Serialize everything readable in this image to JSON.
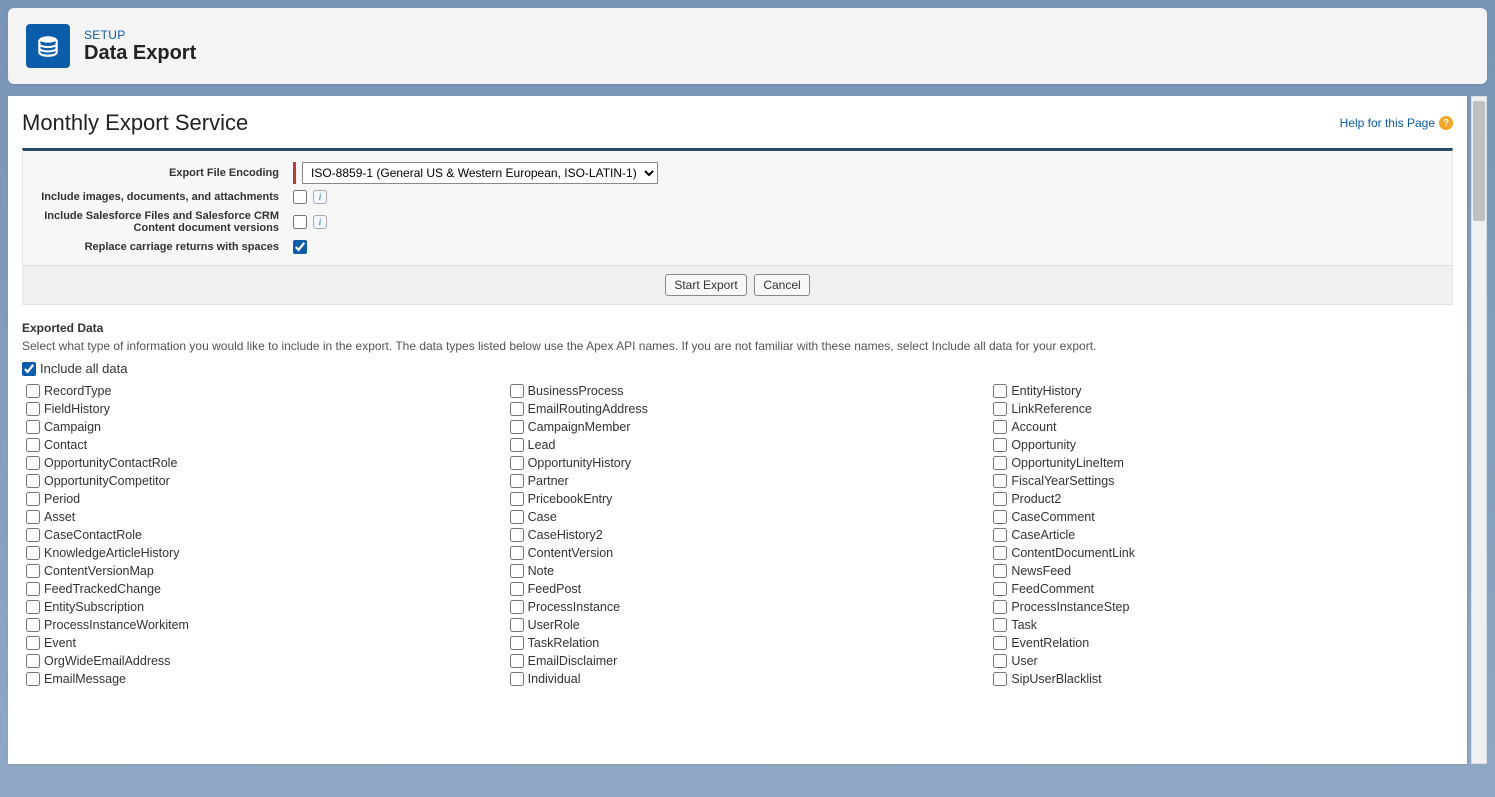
{
  "header": {
    "setup_label": "SETUP",
    "page_title": "Data Export"
  },
  "section": {
    "title": "Monthly Export Service",
    "help_text": "Help for this Page"
  },
  "form": {
    "encoding_label": "Export File Encoding",
    "encoding_value": "ISO-8859-1 (General US & Western European, ISO-LATIN-1)",
    "include_attachments_label": "Include images, documents, and attachments",
    "include_files_label": "Include Salesforce Files and Salesforce CRM Content document versions",
    "replace_cr_label": "Replace carriage returns with spaces"
  },
  "buttons": {
    "start": "Start Export",
    "cancel": "Cancel"
  },
  "exported": {
    "heading": "Exported Data",
    "description": "Select what type of information you would like to include in the export. The data types listed below use the Apex API names. If you are not familiar with these names, select Include all data for your export.",
    "include_all_label": "Include all data"
  },
  "data_types": {
    "col1": [
      "RecordType",
      "FieldHistory",
      "Campaign",
      "Contact",
      "OpportunityContactRole",
      "OpportunityCompetitor",
      "Period",
      "Asset",
      "CaseContactRole",
      "KnowledgeArticleHistory",
      "ContentVersionMap",
      "FeedTrackedChange",
      "EntitySubscription",
      "ProcessInstanceWorkitem",
      "Event",
      "OrgWideEmailAddress",
      "EmailMessage"
    ],
    "col2": [
      "BusinessProcess",
      "EmailRoutingAddress",
      "CampaignMember",
      "Lead",
      "OpportunityHistory",
      "Partner",
      "PricebookEntry",
      "Case",
      "CaseHistory2",
      "ContentVersion",
      "Note",
      "FeedPost",
      "ProcessInstance",
      "UserRole",
      "TaskRelation",
      "EmailDisclaimer",
      "Individual"
    ],
    "col3": [
      "EntityHistory",
      "LinkReference",
      "Account",
      "Opportunity",
      "OpportunityLineItem",
      "FiscalYearSettings",
      "Product2",
      "CaseComment",
      "CaseArticle",
      "ContentDocumentLink",
      "NewsFeed",
      "FeedComment",
      "ProcessInstanceStep",
      "Task",
      "EventRelation",
      "User",
      "SipUserBlacklist"
    ]
  }
}
